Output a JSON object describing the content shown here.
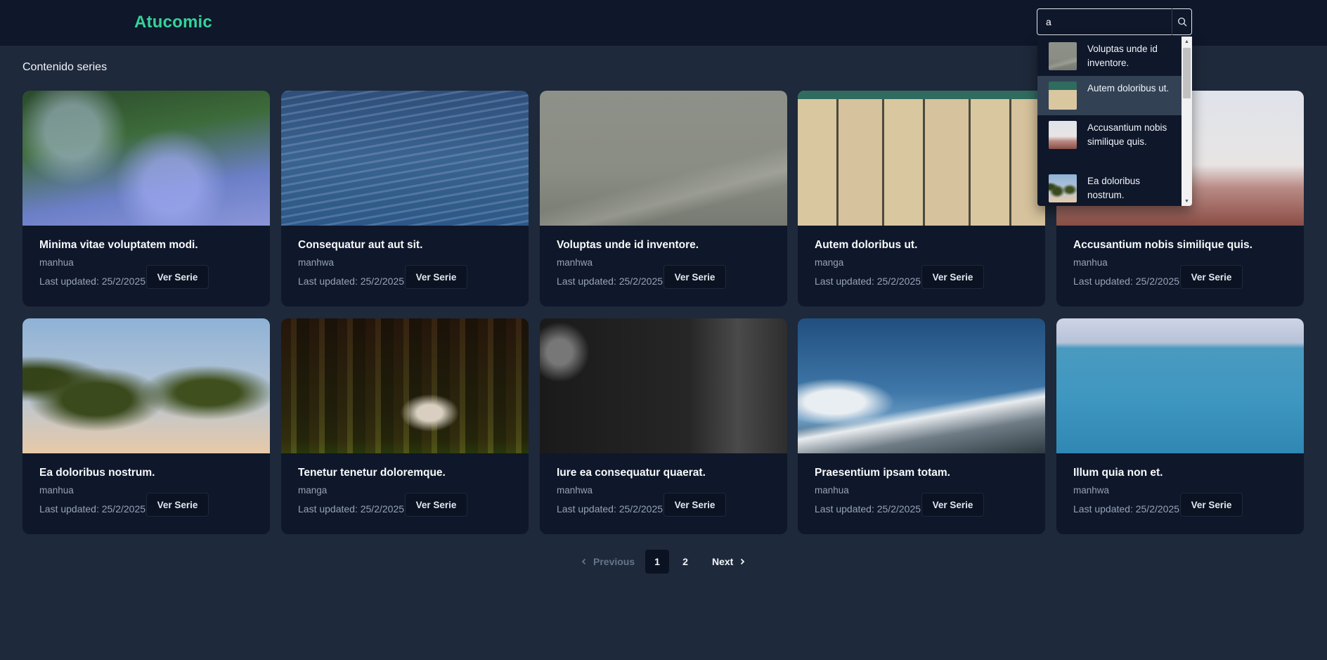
{
  "app": {
    "logo": "Atucomic",
    "accent_color": "#34d399"
  },
  "search": {
    "value": "a",
    "results": [
      {
        "title": "Voluptas unde id inventore.",
        "thumb": "fog-icon"
      },
      {
        "title": "Autem doloribus ut.",
        "thumb": "wood-icon"
      },
      {
        "title": "Accusantium nobis similique quis.",
        "thumb": "desert-icon"
      },
      {
        "title": "Ea doloribus nostrum.",
        "thumb": "palms-icon"
      }
    ]
  },
  "section": {
    "title": "Contenido series"
  },
  "cards": [
    {
      "title": "Minima vitae voluptatem modi.",
      "type": "manhua",
      "updated": "Last updated: 25/2/2025",
      "button": "Ver Serie"
    },
    {
      "title": "Consequatur aut aut sit.",
      "type": "manhwa",
      "updated": "Last updated: 25/2/2025",
      "button": "Ver Serie"
    },
    {
      "title": "Voluptas unde id inventore.",
      "type": "manhwa",
      "updated": "Last updated: 25/2/2025",
      "button": "Ver Serie"
    },
    {
      "title": "Autem doloribus ut.",
      "type": "manga",
      "updated": "Last updated: 25/2/2025",
      "button": "Ver Serie"
    },
    {
      "title": "Accusantium nobis similique quis.",
      "type": "manhua",
      "updated": "Last updated: 25/2/2025",
      "button": "Ver Serie"
    },
    {
      "title": "Ea doloribus nostrum.",
      "type": "manhua",
      "updated": "Last updated: 25/2/2025",
      "button": "Ver Serie"
    },
    {
      "title": "Tenetur tenetur doloremque.",
      "type": "manga",
      "updated": "Last updated: 25/2/2025",
      "button": "Ver Serie"
    },
    {
      "title": "Iure ea consequatur quaerat.",
      "type": "manhwa",
      "updated": "Last updated: 25/2/2025",
      "button": "Ver Serie"
    },
    {
      "title": "Praesentium ipsam totam.",
      "type": "manhua",
      "updated": "Last updated: 25/2/2025",
      "button": "Ver Serie"
    },
    {
      "title": "Illum quia non et.",
      "type": "manhwa",
      "updated": "Last updated: 25/2/2025",
      "button": "Ver Serie"
    }
  ],
  "pagination": {
    "previous": "Previous",
    "pages": [
      "1",
      "2"
    ],
    "current": "1",
    "next": "Next"
  }
}
